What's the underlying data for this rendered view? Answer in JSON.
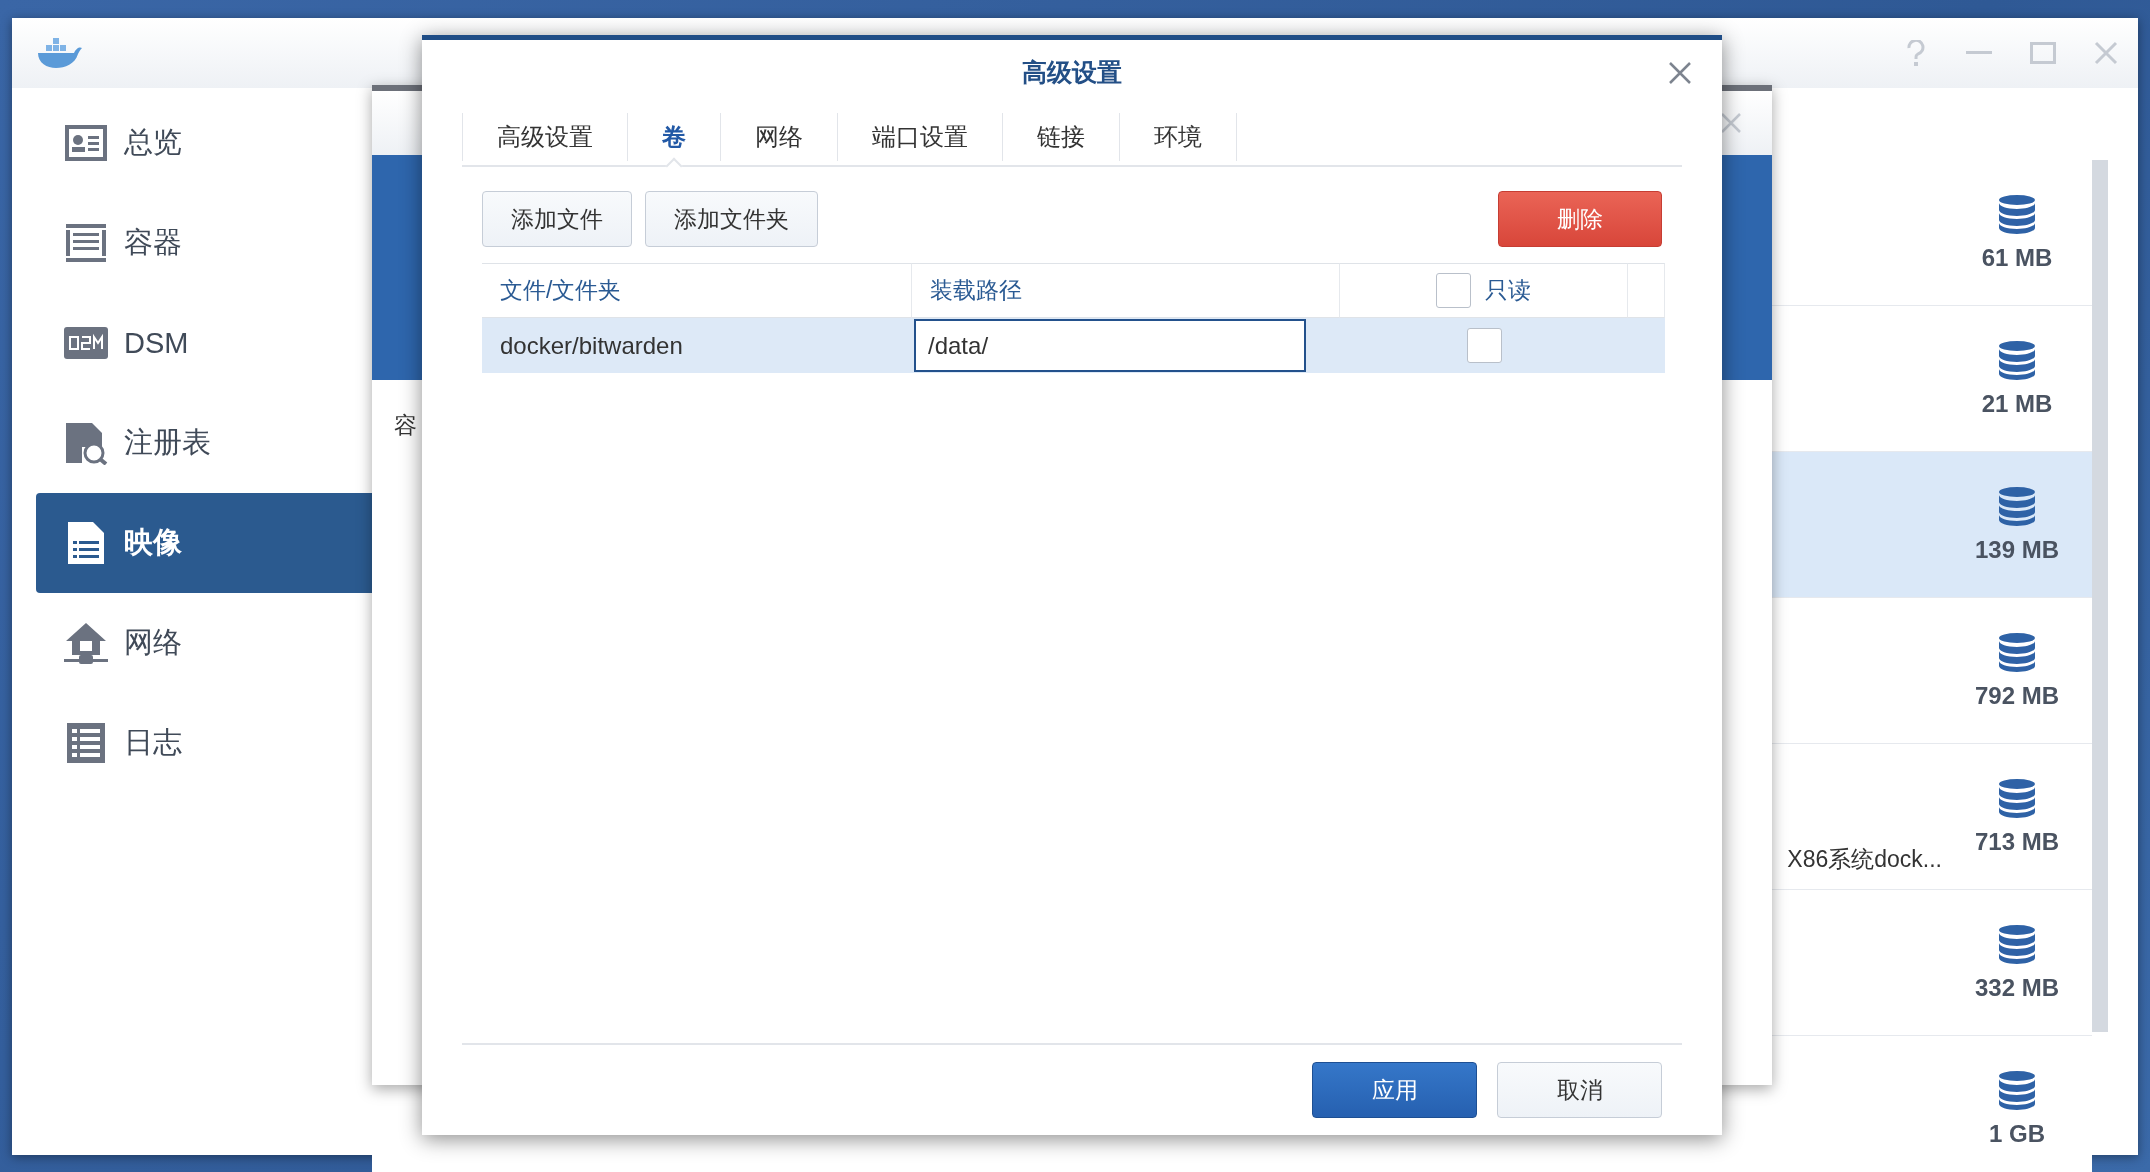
{
  "sidebar": [
    {
      "label": "总览",
      "selected": false
    },
    {
      "label": "容器",
      "selected": false
    },
    {
      "label": "DSM",
      "selected": false
    },
    {
      "label": "注册表",
      "selected": false
    },
    {
      "label": "映像",
      "selected": true
    },
    {
      "label": "网络",
      "selected": false
    },
    {
      "label": "日志",
      "selected": false
    }
  ],
  "images": [
    {
      "size": "61 MB",
      "selected": false
    },
    {
      "size": "21 MB",
      "selected": false
    },
    {
      "size": "139 MB",
      "selected": true
    },
    {
      "size": "792 MB",
      "selected": false
    },
    {
      "size": "713 MB",
      "description": "X86系统dock...",
      "selected": false
    },
    {
      "size": "332 MB",
      "selected": false
    },
    {
      "size": "1 GB",
      "selected": false
    }
  ],
  "background_dialog": {
    "label": "容"
  },
  "dialog": {
    "title": "高级设置",
    "tabs": [
      {
        "label": "高级设置",
        "selected": false
      },
      {
        "label": "卷",
        "selected": true
      },
      {
        "label": "网络",
        "selected": false
      },
      {
        "label": "端口设置",
        "selected": false
      },
      {
        "label": "链接",
        "selected": false
      },
      {
        "label": "环境",
        "selected": false
      }
    ],
    "toolbar": {
      "add_file": "添加文件",
      "add_folder": "添加文件夹",
      "delete": "删除"
    },
    "table": {
      "columns": [
        "文件/文件夹",
        "装载路径"
      ],
      "readonly_header": {
        "label": "只读",
        "checked": false
      },
      "rows": [
        {
          "file": "docker/bitwarden",
          "mount_path": "/data/",
          "readonly": false,
          "selected": true
        }
      ]
    },
    "footer": {
      "apply": "应用",
      "cancel": "取消"
    }
  }
}
